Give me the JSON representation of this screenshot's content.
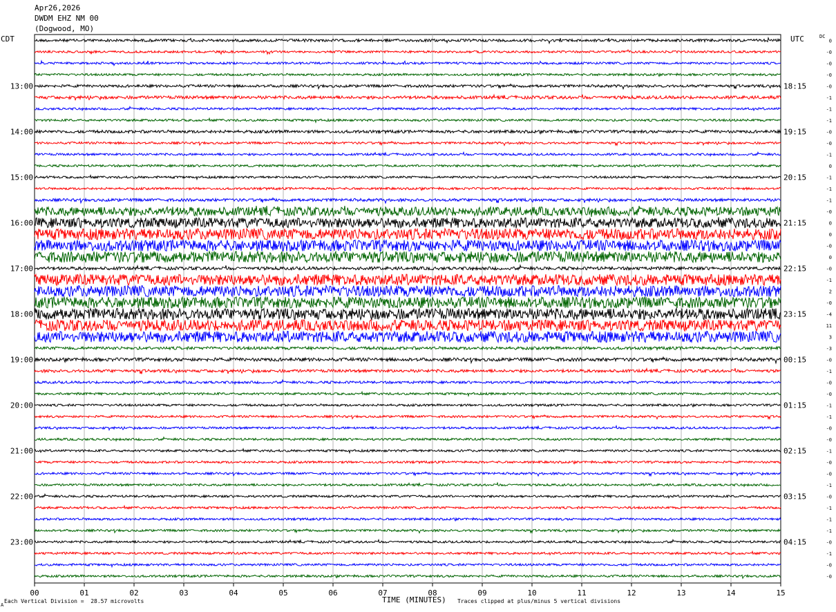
{
  "header": {
    "date": "Apr26,2026",
    "station": "DWDM EHZ NM 00",
    "location": "(Dogwood, MO)"
  },
  "axis_labels": {
    "left_zone": "CDT",
    "right_zone": "UTC",
    "dc": "DC",
    "x": "TIME (MINUTES)"
  },
  "footer": {
    "scale_label": "Each Vertical Division =",
    "scale_value": "28.57 microvolts",
    "clip_note": "Traces clipped at plus/minus 5 vertical divisions",
    "corner_mark": "A"
  },
  "colors": {
    "trace_cycle": [
      "#000000",
      "#ff0000",
      "#0000ff",
      "#006400"
    ],
    "grid": "#b4b4b4"
  },
  "chart_data": {
    "type": "helicorder",
    "xlabel": "TIME (MINUTES)",
    "x_ticks": [
      "00",
      "01",
      "02",
      "03",
      "04",
      "05",
      "06",
      "07",
      "08",
      "09",
      "10",
      "11",
      "12",
      "13",
      "14",
      "15"
    ],
    "xlim": [
      0,
      15
    ],
    "rows_per_hour": 4,
    "row_count": 48,
    "left_hour_labels": [
      "13:00",
      "14:00",
      "15:00",
      "16:00",
      "17:00",
      "18:00",
      "19:00",
      "20:00",
      "21:00",
      "22:00",
      "23:00"
    ],
    "right_hour_labels": [
      "18:15",
      "19:15",
      "20:15",
      "21:15",
      "22:15",
      "23:15",
      "00:15",
      "01:15",
      "02:15",
      "03:15",
      "04:15"
    ],
    "first_labeled_row": 4,
    "dc_offsets": [
      "0",
      "-0",
      "-0",
      "-0",
      "-0",
      "-1",
      "-1",
      "-1",
      "-0",
      "-0",
      "-1",
      "0",
      "-1",
      "-1",
      "-1",
      "-0",
      "0",
      "0",
      "-0",
      "0",
      "-0",
      "-1",
      "2",
      "-0",
      "-4",
      "11",
      "3",
      "-3",
      "-0",
      "-1",
      "-0",
      "-0",
      "-1",
      "-1",
      "-0",
      "-0",
      "-1",
      "-0",
      "-0",
      "-1",
      "-0",
      "-1",
      "-1",
      "-1",
      "-0",
      "-1",
      "-0",
      "-0"
    ],
    "trace_amplitude_divisions": [
      1.2,
      1.0,
      1.0,
      1.0,
      1.2,
      1.4,
      1.0,
      1.0,
      1.3,
      1.0,
      1.0,
      1.0,
      1.0,
      1.0,
      1.3,
      4.0,
      4.5,
      5.0,
      5.0,
      5.0,
      1.4,
      5.0,
      5.0,
      5.0,
      5.0,
      5.0,
      5.0,
      1.3,
      1.5,
      1.3,
      1.1,
      1.0,
      1.0,
      1.0,
      1.0,
      1.0,
      1.0,
      1.0,
      1.0,
      1.0,
      1.0,
      1.0,
      1.0,
      1.0,
      1.0,
      1.0,
      1.0,
      1.0
    ],
    "clip_divisions": 5,
    "scale_microvolts_per_division": 28.57
  }
}
